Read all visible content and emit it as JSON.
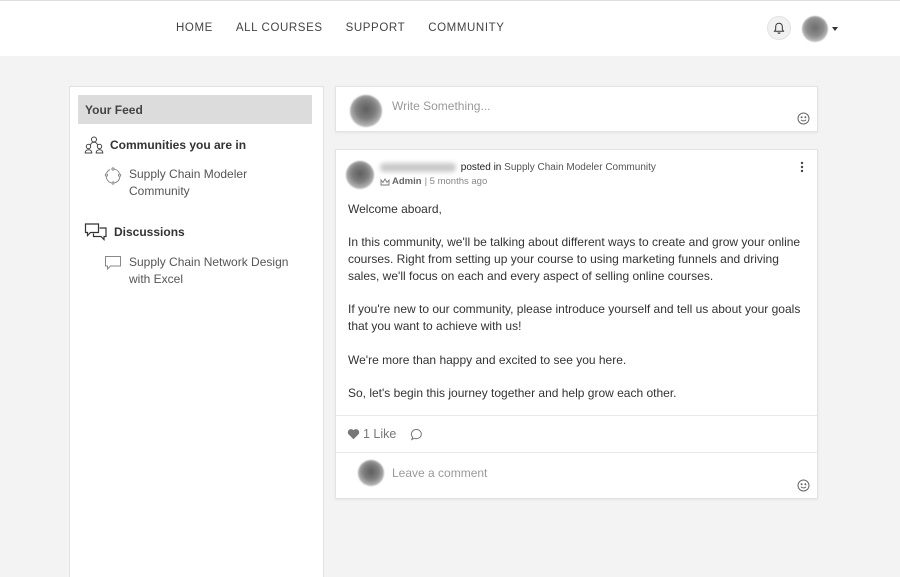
{
  "nav": {
    "items": [
      {
        "label": "HOME"
      },
      {
        "label": "ALL COURSES"
      },
      {
        "label": "SUPPORT"
      },
      {
        "label": "COMMUNITY"
      }
    ]
  },
  "header": {
    "icons": [
      "bell-icon",
      "avatar",
      "caret-down-icon"
    ]
  },
  "sidebar": {
    "feed_label": "Your Feed",
    "communities": {
      "title": "Communities you are in",
      "icon": "people-group-icon",
      "items": [
        {
          "label": "Supply Chain Modeler Community",
          "icon": "sync-circle-icon"
        }
      ]
    },
    "discussions": {
      "title": "Discussions",
      "icon": "chat-bubbles-icon",
      "items": [
        {
          "label": "Supply Chain Network Design with Excel",
          "icon": "chat-bubble-icon"
        }
      ]
    }
  },
  "composer": {
    "placeholder": "Write Something..."
  },
  "post": {
    "posted_in": "posted in",
    "community": "Supply Chain Modeler Community",
    "role": "Admin",
    "time": "| 5 months ago",
    "paragraphs": [
      "Welcome aboard,",
      "In this community, we'll be talking about different ways to create and grow your online courses. Right from setting up your course to using marketing funnels and driving sales, we'll focus on each and every aspect of selling online courses.",
      "If you're new to our community, please introduce yourself and tell us about your goals that you want to achieve with us!",
      "We're more than happy and excited to see you here.",
      "So, let's begin this journey together and help grow each other."
    ],
    "likes": "1 Like"
  },
  "comment": {
    "placeholder": "Leave a comment"
  },
  "colors": {
    "background": "#f3f3f3",
    "card": "#ffffff",
    "feed_header": "#dcdcdc"
  }
}
